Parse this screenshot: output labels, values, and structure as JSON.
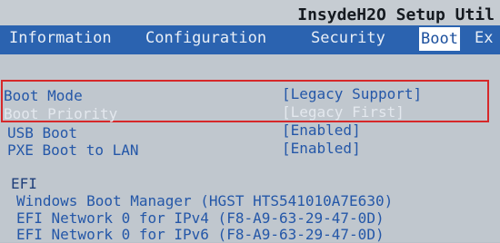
{
  "header": {
    "title": "InsydeH2O Setup Util"
  },
  "menu": {
    "tabs": [
      {
        "label": "Information"
      },
      {
        "label": "Configuration"
      },
      {
        "label": "Security"
      },
      {
        "label": "Boot"
      },
      {
        "label": "Ex"
      }
    ],
    "active_tab": "Boot"
  },
  "settings": [
    {
      "label": "Boot Mode",
      "value": "[Legacy Support]"
    },
    {
      "label": "Boot Priority",
      "value": "[Legacy First]"
    },
    {
      "label": "USB Boot",
      "value": "[Enabled]"
    },
    {
      "label": "PXE Boot to LAN",
      "value": "[Enabled]"
    }
  ],
  "efi": {
    "heading": "EFI",
    "entries": [
      "Windows Boot Manager (HGST HTS541010A7E630)",
      "EFI Network 0 for IPv4 (F8-A9-63-29-47-0D)",
      "EFI Network 0 for IPv6 (F8-A9-63-29-47-0D)"
    ]
  },
  "colors": {
    "menu_bg": "#2b63b0",
    "text_blue": "#2457a8",
    "highlight_red": "#d6282a"
  }
}
